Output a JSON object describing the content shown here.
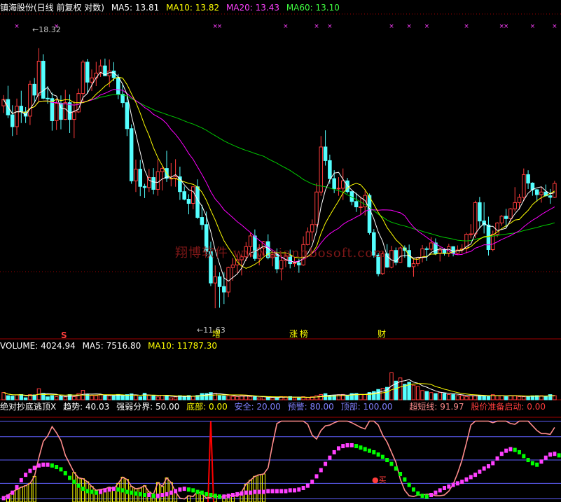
{
  "main_header": {
    "title": "镇海股份(日线 前复权 对数)",
    "ma5": "MA5: 13.81",
    "ma10": "MA10: 13.82",
    "ma20": "MA20: 13.43",
    "ma60": "MA60: 13.10"
  },
  "volume_header": {
    "volume": "VOLUME: 4024.94",
    "ma5": "MA5: 7516.80",
    "ma10": "MA10: 11787.30"
  },
  "indicator_header": {
    "name": "绝对抄底逃顶X",
    "trend": "趋势: 40.03",
    "divide": "强弱分界: 50.00",
    "bottom": "底部: 0.00",
    "safe": "安全: 20.00",
    "warn": "预警: 80.00",
    "top": "顶部: 100.00",
    "ultra": "超短线: 91.97",
    "launch": "股价准备启动: 0.00"
  },
  "annotations": {
    "high_label": "18.32",
    "low_label": "11.63",
    "event_s": "S",
    "event_zeng": "增",
    "event_zhang": "涨",
    "event_bang": "榜",
    "event_cai": "财",
    "buy_label": "买",
    "watermark": "翔博软件 www.xiangbosoft.com"
  },
  "colors": {
    "up": "#ff3c3c",
    "down": "#54ffff",
    "ma5": "#ffffff",
    "ma10": "#ffff00",
    "ma20": "#ff00ff",
    "ma60": "#00c800",
    "pink": "#ff8c8c",
    "magenta": "#ff40ff",
    "green": "#00ff00"
  },
  "chart_data": [
    {
      "type": "candlestick",
      "yscale": "log",
      "ylim": [
        10.6,
        19.4
      ],
      "highest": 18.32,
      "lowest": 11.63,
      "candles": [
        [
          16.41,
          16.75,
          16.19,
          16.61
        ],
        [
          16.61,
          17.05,
          16.03,
          16.13
        ],
        [
          16.13,
          16.43,
          15.49,
          15.77
        ],
        [
          15.77,
          16.64,
          15.52,
          16.4
        ],
        [
          16.4,
          16.89,
          15.88,
          16.22
        ],
        [
          16.22,
          16.37,
          15.88,
          16.09
        ],
        [
          16.09,
          17.22,
          15.82,
          17.1
        ],
        [
          17.1,
          17.31,
          16.55,
          16.75
        ],
        [
          16.75,
          18.32,
          16.52,
          17.87
        ],
        [
          17.87,
          18.11,
          16.62,
          16.65
        ],
        [
          16.65,
          17.04,
          16.48,
          16.64
        ],
        [
          16.64,
          16.83,
          15.65,
          15.95
        ],
        [
          15.95,
          16.65,
          15.67,
          16.49
        ],
        [
          16.49,
          16.74,
          15.69,
          15.99
        ],
        [
          15.99,
          16.92,
          15.97,
          16.51
        ],
        [
          16.51,
          16.77,
          15.58,
          15.99
        ],
        [
          15.99,
          16.56,
          15.43,
          16.22
        ],
        [
          16.22,
          16.96,
          16.19,
          16.8
        ],
        [
          16.8,
          17.91,
          16.53,
          17.84
        ],
        [
          17.84,
          17.95,
          16.81,
          17.17
        ],
        [
          17.17,
          17.59,
          16.88,
          17.31
        ],
        [
          17.31,
          17.85,
          17.04,
          17.47
        ],
        [
          17.47,
          17.93,
          17.34,
          17.71
        ],
        [
          17.71,
          17.96,
          17.38,
          17.38
        ],
        [
          17.38,
          17.93,
          17.01,
          17.54
        ],
        [
          17.54,
          17.84,
          17.2,
          17.32
        ],
        [
          17.32,
          17.44,
          16.62,
          16.78
        ],
        [
          16.78,
          17.11,
          16.36,
          16.51
        ],
        [
          16.51,
          16.69,
          15.49,
          15.71
        ],
        [
          15.71,
          15.84,
          14.14,
          14.22
        ],
        [
          14.22,
          14.81,
          13.92,
          14.54
        ],
        [
          14.54,
          14.8,
          13.81,
          14.07
        ],
        [
          14.07,
          14.14,
          13.76,
          14.04
        ],
        [
          14.04,
          14.55,
          13.92,
          14.31
        ],
        [
          14.31,
          14.57,
          13.86,
          13.99
        ],
        [
          13.99,
          14.82,
          13.82,
          14.47
        ],
        [
          14.47,
          14.62,
          13.96,
          14.56
        ],
        [
          14.56,
          15.06,
          14.19,
          14.29
        ],
        [
          14.29,
          14.71,
          14.07,
          14.29
        ],
        [
          14.29,
          14.82,
          14.06,
          14.33
        ],
        [
          14.33,
          14.61,
          13.71,
          13.93
        ],
        [
          13.93,
          14.07,
          13.7,
          13.73
        ],
        [
          13.73,
          13.86,
          13.34,
          13.62
        ],
        [
          13.62,
          14.06,
          13.47,
          14.06
        ],
        [
          14.06,
          14.26,
          13.22,
          13.26
        ],
        [
          13.26,
          13.58,
          12.95,
          13.08
        ],
        [
          13.08,
          13.41,
          12.31,
          12.42
        ],
        [
          12.42,
          12.66,
          11.63,
          11.7
        ],
        [
          11.7,
          12.1,
          11.15,
          11.84
        ],
        [
          11.84,
          11.94,
          11.16,
          11.62
        ],
        [
          11.62,
          11.94,
          11.24,
          11.5
        ],
        [
          11.5,
          12.07,
          11.39,
          12.05
        ],
        [
          12.05,
          12.27,
          11.75,
          12.11
        ],
        [
          12.11,
          12.36,
          11.92,
          12.23
        ],
        [
          12.23,
          12.37,
          11.87,
          12.3
        ],
        [
          12.3,
          12.65,
          12.2,
          12.54
        ],
        [
          12.54,
          12.87,
          12.29,
          12.8
        ],
        [
          12.8,
          12.96,
          12.2,
          12.26
        ],
        [
          12.26,
          12.6,
          12.1,
          12.51
        ],
        [
          12.51,
          12.68,
          12.29,
          12.66
        ],
        [
          12.66,
          12.84,
          12.24,
          12.28
        ],
        [
          12.28,
          12.38,
          12.08,
          12.35
        ],
        [
          12.35,
          12.5,
          11.92,
          12.02
        ],
        [
          12.02,
          12.35,
          11.76,
          12.21
        ],
        [
          12.21,
          12.38,
          12.06,
          12.32
        ],
        [
          12.32,
          12.47,
          12.03,
          12.14
        ],
        [
          12.14,
          12.28,
          12.07,
          12.16
        ],
        [
          12.16,
          12.25,
          11.93,
          12.11
        ],
        [
          12.11,
          12.79,
          12.09,
          12.59
        ],
        [
          12.59,
          13.01,
          12.57,
          12.9
        ],
        [
          12.9,
          13.21,
          12.67,
          13.08
        ],
        [
          13.08,
          14.16,
          13.03,
          13.92
        ],
        [
          13.92,
          15.49,
          13.82,
          15.17
        ],
        [
          15.17,
          15.66,
          14.64,
          14.78
        ],
        [
          14.78,
          14.95,
          14.14,
          14.28
        ],
        [
          14.28,
          14.51,
          13.89,
          14.01
        ],
        [
          14.01,
          14.32,
          13.82,
          14.02
        ],
        [
          14.02,
          14.56,
          13.71,
          14.22
        ],
        [
          14.22,
          14.3,
          13.88,
          13.93
        ],
        [
          13.93,
          13.94,
          13.57,
          13.67
        ],
        [
          13.67,
          13.9,
          13.4,
          13.53
        ],
        [
          13.53,
          13.8,
          13.32,
          13.53
        ],
        [
          13.53,
          13.96,
          13.31,
          13.83
        ],
        [
          13.83,
          13.88,
          12.83,
          12.88
        ],
        [
          12.88,
          12.97,
          12.28,
          12.34
        ],
        [
          12.34,
          12.39,
          11.85,
          11.91
        ],
        [
          11.91,
          12.43,
          11.88,
          12.37
        ],
        [
          12.37,
          12.6,
          12.04,
          12.06
        ],
        [
          12.06,
          12.56,
          12.03,
          12.45
        ],
        [
          12.45,
          12.52,
          12.1,
          12.17
        ],
        [
          12.17,
          12.54,
          12.16,
          12.51
        ],
        [
          12.51,
          12.57,
          12.28,
          12.45
        ],
        [
          12.45,
          12.59,
          12.05,
          12.07
        ],
        [
          12.07,
          12.24,
          11.84,
          12.14
        ],
        [
          12.14,
          12.3,
          12.08,
          12.28
        ],
        [
          12.28,
          12.58,
          12.17,
          12.49
        ],
        [
          12.49,
          12.54,
          12.2,
          12.48
        ],
        [
          12.48,
          12.77,
          12.44,
          12.63
        ],
        [
          12.63,
          12.74,
          12.34,
          12.38
        ],
        [
          12.38,
          12.53,
          12.19,
          12.46
        ],
        [
          12.46,
          12.51,
          12.33,
          12.38
        ],
        [
          12.38,
          12.61,
          12.3,
          12.54
        ],
        [
          12.54,
          12.55,
          12.31,
          12.38
        ],
        [
          12.38,
          12.57,
          12.35,
          12.46
        ],
        [
          12.46,
          12.6,
          12.38,
          12.49
        ],
        [
          12.49,
          12.88,
          12.38,
          12.84
        ],
        [
          12.84,
          13.09,
          12.74,
          12.85
        ],
        [
          12.85,
          13.69,
          12.75,
          13.64
        ],
        [
          13.64,
          13.79,
          12.99,
          13.17
        ],
        [
          13.17,
          13.65,
          12.86,
          13.07
        ],
        [
          13.07,
          13.28,
          12.33,
          12.47
        ],
        [
          12.47,
          12.93,
          12.43,
          12.84
        ],
        [
          12.84,
          13.14,
          12.77,
          13.12
        ],
        [
          13.12,
          13.32,
          13.05,
          13.29
        ],
        [
          13.29,
          13.48,
          13.02,
          13.23
        ],
        [
          13.23,
          13.5,
          13.15,
          13.48
        ],
        [
          13.48,
          14.05,
          13.41,
          13.64
        ],
        [
          13.64,
          13.87,
          13.46,
          13.78
        ],
        [
          13.78,
          14.56,
          13.68,
          14.39
        ],
        [
          14.39,
          14.51,
          14.0,
          14.16
        ],
        [
          14.16,
          14.18,
          13.82,
          13.98
        ],
        [
          13.98,
          14.0,
          13.67,
          13.85
        ],
        [
          13.85,
          14.05,
          13.64,
          13.92
        ],
        [
          13.92,
          14.12,
          13.8,
          13.82
        ],
        [
          13.82,
          14.0,
          13.61,
          13.78
        ],
        [
          13.78,
          14.22,
          13.76,
          14.15
        ]
      ],
      "moving_averages": [
        "MA5",
        "MA10",
        "MA20",
        "MA60"
      ]
    },
    {
      "type": "bar",
      "title": "VOLUME",
      "ylim": [
        0,
        48000
      ],
      "values": [
        7049,
        3949,
        3574,
        4662,
        5102,
        1938,
        4998,
        4734,
        10669,
        6216,
        2871,
        3986,
        3124,
        3418,
        2815,
        5016,
        3097,
        6010,
        9061,
        5149,
        4104,
        4006,
        5009,
        4106,
        3828,
        3864,
        5127,
        3961,
        5007,
        5716,
        4155,
        2929,
        6262,
        4096,
        4196,
        2790,
        4271,
        4219,
        1863,
        2768,
        4025,
        2896,
        4126,
        3305,
        4224,
        6030,
        6048,
        6945,
        6149,
        3937,
        3738,
        3776,
        3286,
        3189,
        4001,
        4050,
        3188,
        2818,
        1911,
        3025,
        1982,
        2096,
        2043,
        3088,
        2999,
        3079,
        2020,
        1935,
        2963,
        2001,
        2906,
        3997,
        5096,
        5927,
        4003,
        4150,
        4929,
        5135,
        4085,
        6009,
        6086,
        5097,
        5079,
        7046,
        7915,
        9974,
        11066,
        12048,
        26121,
        18045,
        21101,
        14999,
        16930,
        14073,
        12899,
        8939,
        8024,
        6951,
        6008,
        6971,
        6008,
        5068,
        5016,
        4006,
        3978,
        3073,
        3892,
        3952,
        4138,
        3994,
        3080,
        4958,
        4054,
        3995,
        3008,
        3930,
        4012,
        3100,
        2989,
        3015,
        3893,
        4041,
        3983,
        3020,
        4994,
        4025
      ]
    },
    {
      "type": "line",
      "title": "绝对抄底逃顶X",
      "ylim": [
        -4,
        114
      ],
      "reference_lines": [
        100,
        80,
        50,
        20,
        0
      ],
      "series": [
        {
          "name": "趋势",
          "values": [
            1,
            3,
            8,
            15,
            24,
            31,
            36,
            40,
            43,
            44,
            44,
            43,
            41,
            38,
            33,
            27,
            22,
            17,
            13,
            10,
            9,
            8,
            9,
            11,
            12,
            13,
            12,
            11,
            9,
            8,
            7,
            6,
            5,
            5,
            4,
            4,
            5,
            6,
            8,
            10,
            12,
            13,
            12,
            11,
            9,
            8,
            6,
            5,
            4,
            3,
            3,
            4,
            5,
            6,
            7,
            8,
            8,
            9,
            9,
            9,
            10,
            10,
            10,
            10,
            10,
            11,
            11,
            12,
            14,
            17,
            22,
            29,
            37,
            45,
            53,
            60,
            65,
            68,
            69,
            69,
            68,
            66,
            64,
            62,
            60,
            57,
            54,
            50,
            45,
            39,
            32,
            25,
            18,
            12,
            7,
            4,
            3,
            5,
            8,
            11,
            14,
            16,
            18,
            20,
            22,
            25,
            28,
            31,
            35,
            39,
            42,
            46,
            52,
            58,
            62,
            64,
            63,
            60,
            55,
            50,
            46,
            44,
            48,
            53,
            57,
            58,
            56,
            52,
            48,
            44,
            41,
            40
          ]
        },
        {
          "name": "超短线",
          "values": [
            2,
            5,
            9,
            12,
            15,
            17,
            20,
            29,
            53,
            74,
            81,
            93,
            85,
            75,
            56,
            45,
            34,
            27,
            26,
            22,
            16,
            11,
            12,
            13,
            15,
            13,
            20,
            28,
            25,
            16,
            13,
            14,
            17,
            9,
            6,
            21,
            16,
            27,
            21,
            9,
            1,
            0,
            4,
            3,
            10,
            6,
            1,
            2,
            5,
            1,
            4,
            4,
            5,
            3,
            9,
            19,
            24,
            29,
            31,
            32,
            40,
            70,
            97,
            100,
            100,
            100,
            100,
            100,
            100,
            96,
            82,
            77,
            88,
            94,
            95,
            98,
            100,
            100,
            100,
            98,
            95,
            92,
            90,
            100,
            100,
            95,
            82,
            73,
            60,
            47,
            25,
            11,
            4,
            3,
            5,
            5,
            6,
            6,
            4,
            4,
            5,
            10,
            19,
            33,
            50,
            72,
            95,
            100,
            100,
            100,
            100,
            98,
            100,
            100,
            100,
            97,
            96,
            100,
            100,
            100,
            94,
            88,
            84,
            84,
            83,
            92
          ]
        }
      ],
      "buy_marker": "买"
    }
  ]
}
